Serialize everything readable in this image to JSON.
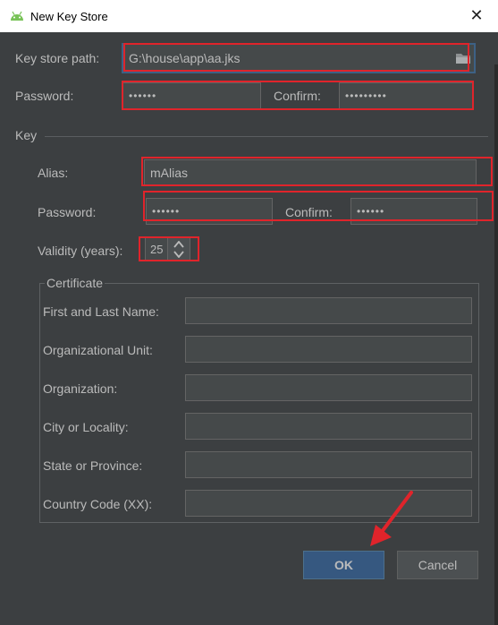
{
  "window": {
    "title": "New Key Store",
    "close_glyph": "✕"
  },
  "keystore": {
    "path_label": "Key store path:",
    "path_value": "G:\\house\\app\\aa.jks",
    "password_label": "Password:",
    "password_value": "••••••",
    "confirm_label": "Confirm:",
    "confirm_value": "•••••••••"
  },
  "key": {
    "section_label": "Key",
    "alias_label": "Alias:",
    "alias_value": "mAlias",
    "password_label": "Password:",
    "password_value": "••••••",
    "confirm_label": "Confirm:",
    "confirm_value": "••••••",
    "validity_label": "Validity (years):",
    "validity_value": "25"
  },
  "certificate": {
    "title": "Certificate",
    "fields": [
      {
        "label": "First and Last Name:",
        "value": ""
      },
      {
        "label": "Organizational Unit:",
        "value": ""
      },
      {
        "label": "Organization:",
        "value": ""
      },
      {
        "label": "City or Locality:",
        "value": ""
      },
      {
        "label": "State or Province:",
        "value": ""
      },
      {
        "label": "Country Code (XX):",
        "value": ""
      }
    ]
  },
  "buttons": {
    "ok_label": "OK",
    "cancel_label": "Cancel"
  },
  "colors": {
    "dialog_bg": "#3c3f41",
    "field_bg": "#45494a",
    "highlight": "#e0242b",
    "ok_bg": "#365880"
  },
  "icons": [
    "android-icon",
    "close-icon",
    "folder-icon",
    "spinner-up-icon",
    "spinner-down-icon",
    "arrow-annotation-icon"
  ]
}
